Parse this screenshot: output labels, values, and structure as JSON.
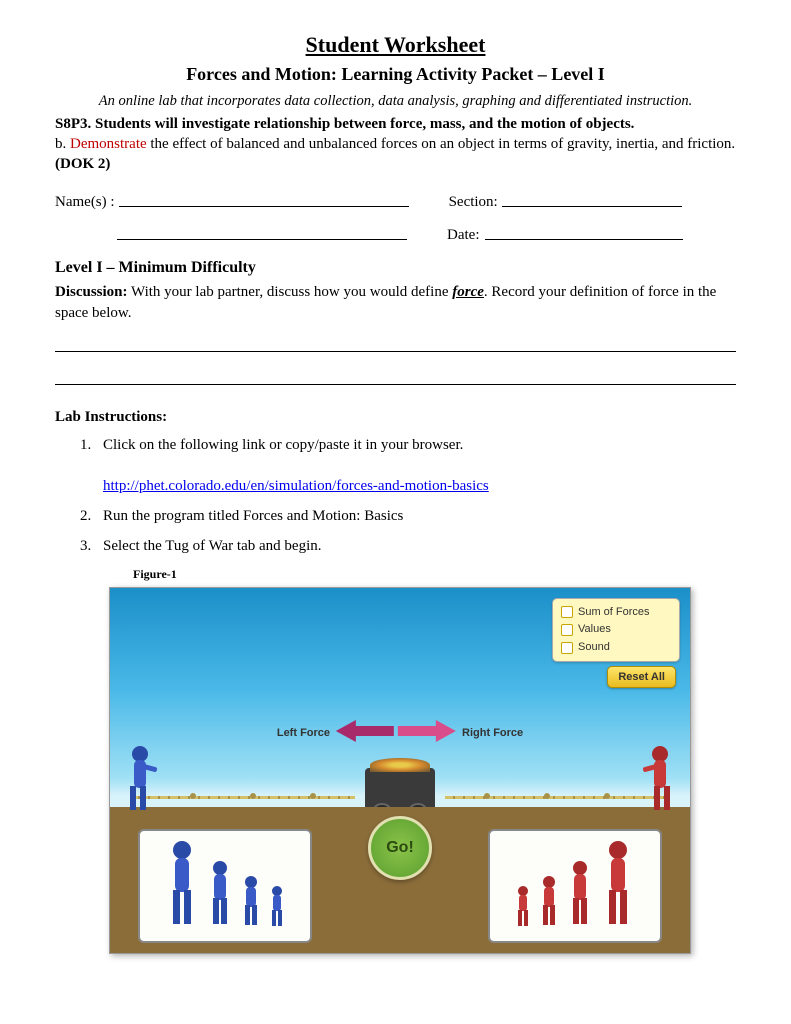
{
  "header": {
    "title": "Student Worksheet",
    "subtitle": "Forces and Motion:  Learning Activity Packet – Level I",
    "description": "An online lab that incorporates data collection, data analysis, graphing and differentiated instruction.",
    "standard_code": "S8P3. Students will investigate relationship between force, mass, and the motion of objects.",
    "sub_prefix": "b. ",
    "sub_red": "Demonstrate",
    "sub_rest": " the effect of balanced and unbalanced forces on an object in terms of gravity, inertia, and friction. ",
    "dok": "(DOK 2)"
  },
  "fields": {
    "name_label1": "Name(s) :",
    "section_label": "Section:",
    "date_label": "Date:"
  },
  "level": {
    "heading": "Level I – Minimum Difficulty",
    "discussion_label": "Discussion:",
    "discussion_text_1": "  With your lab partner, discuss how you would define ",
    "force_word": "force",
    "discussion_text_2": ".  Record your definition of force in the space below."
  },
  "lab": {
    "heading": "Lab Instructions:",
    "step1": "Click on the following link or copy/paste it in your browser.",
    "link": "http://phet.colorado.edu/en/simulation/forces-and-motion-basics",
    "step2": "Run the program titled Forces and Motion:  Basics",
    "step3": "Select the Tug of War tab and begin.",
    "figure_label": "Figure-1"
  },
  "sim": {
    "panel": {
      "opt1": "Sum of Forces",
      "opt2": "Values",
      "opt3": "Sound"
    },
    "reset": "Reset All",
    "left_force": "Left Force",
    "right_force": "Right Force",
    "go": "Go!"
  }
}
